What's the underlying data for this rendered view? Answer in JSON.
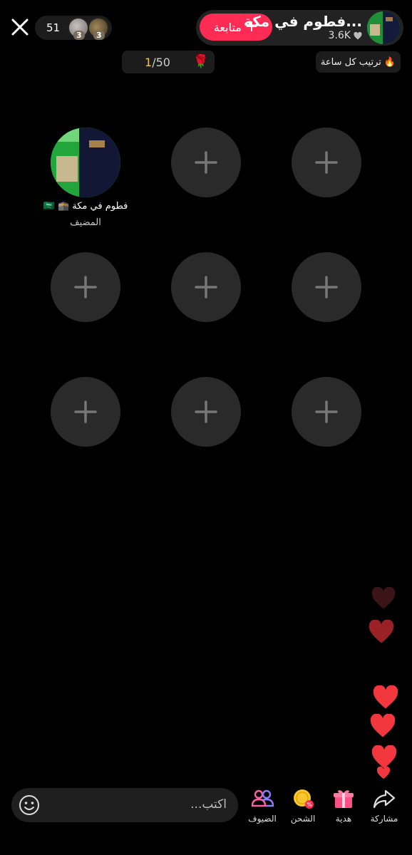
{
  "header": {
    "close_icon": "close-icon",
    "viewer_count": "51",
    "viewer_badges": [
      "3",
      "3"
    ],
    "follow_label": "متابعة",
    "host_name": "فطوم في مكة...",
    "host_likes": "3.6K",
    "rank_current": "1",
    "rank_total": "/50",
    "hourly_label": "ترتيب كل ساعة"
  },
  "seats": {
    "host_name": "فطوم في مكة 🕋 🇸🇦",
    "host_role": "المضيف"
  },
  "bottom": {
    "comment_placeholder": "اكتب...",
    "actions": [
      {
        "label": "الضيوف",
        "icon": "guests-icon"
      },
      {
        "label": "الشحن",
        "icon": "recharge-coin-icon"
      },
      {
        "label": "هدية",
        "icon": "gift-icon"
      },
      {
        "label": "مشاركة",
        "icon": "share-icon"
      }
    ]
  },
  "colors": {
    "follow_button": "#fe2c55",
    "heart": "#f2383e",
    "seat_bg": "#2a2a2a"
  }
}
